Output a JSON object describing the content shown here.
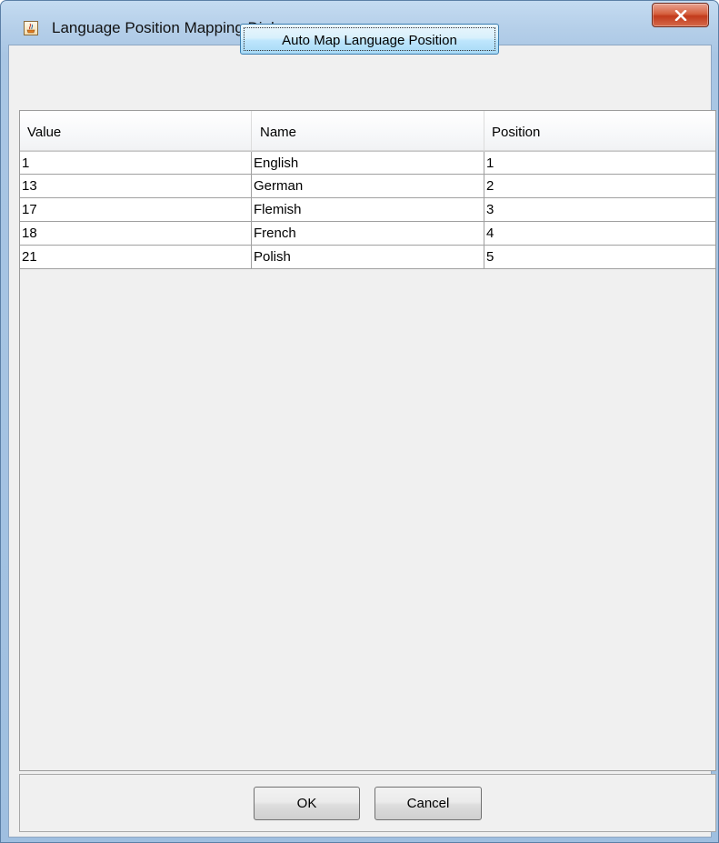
{
  "window": {
    "title": "Language Position Mapping Dialog",
    "close_icon": "close-x-icon",
    "app_icon": "java-cup-icon"
  },
  "toolbar": {
    "auto_map_label": "Auto Map Language Position"
  },
  "table": {
    "columns": [
      "Value",
      "Name",
      "Position"
    ],
    "rows": [
      {
        "value": "1",
        "name": "English",
        "position": "1"
      },
      {
        "value": "13",
        "name": "German",
        "position": "2"
      },
      {
        "value": "17",
        "name": "Flemish",
        "position": "3"
      },
      {
        "value": "18",
        "name": "French",
        "position": "4"
      },
      {
        "value": "21",
        "name": "Polish",
        "position": "5"
      }
    ]
  },
  "footer": {
    "ok_label": "OK",
    "cancel_label": "Cancel"
  },
  "colors": {
    "title_bar": "#b5cfe9",
    "close_button": "#c23b1c",
    "focused_button": "#bee6fd",
    "content_background": "#f0f0f0"
  }
}
